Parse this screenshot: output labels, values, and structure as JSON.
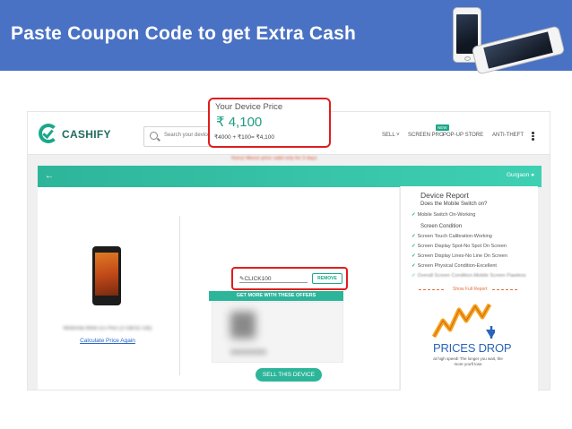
{
  "banner": {
    "title": "Paste Coupon Code to get Extra Cash",
    "background_color": "#4a72c4"
  },
  "site": {
    "logo_text": "CASHIFY",
    "search_placeholder": "Search your device to sell",
    "nav": [
      {
        "label": "SELL ˅"
      },
      {
        "label": "SCREEN PRO"
      },
      {
        "label": "POP-UP STORE"
      },
      {
        "label": "ANTI-THEFT"
      }
    ],
    "new_badge": "NEW",
    "location": "Gurgaon",
    "accent_color": "#2db59a"
  },
  "device": {
    "name": "Motorola Moto E5 Plus (3 GB/32 GB)",
    "calc_again_label": "Calculate Price Again"
  },
  "price": {
    "title": "Your Device Price",
    "value": "₹ 4,100",
    "breakup": "₹4000 + ₹100= ₹4,100",
    "hurry_text": "Hurry! Above price valid only for 3 days"
  },
  "coupon": {
    "code": "CLICK100",
    "remove_label": "REMOVE"
  },
  "offers": {
    "header": "GET MORE WITH THESE OFFERS"
  },
  "sell_button": "SELL THIS DEVICE",
  "report": {
    "title": "Device Report",
    "question": "Does the Mobile Switch on?",
    "switch_answer": "Mobile Switch On-Working",
    "section_condition": "Screen Condition",
    "lines": [
      "Screen Touch Calibration-Working",
      "Screen Display Spot-No Spot On Screen",
      "Screen Display Lines-No Line On Screen",
      "Screen Physical Condition-Excellent",
      "Overall Screen Condition-Mobile Screen Flawless"
    ],
    "show_full": "Show Full Report"
  },
  "prices_drop": {
    "title": "PRICES DROP",
    "subtitle": "at high speed! The longer you wait, the more you'll lose"
  }
}
